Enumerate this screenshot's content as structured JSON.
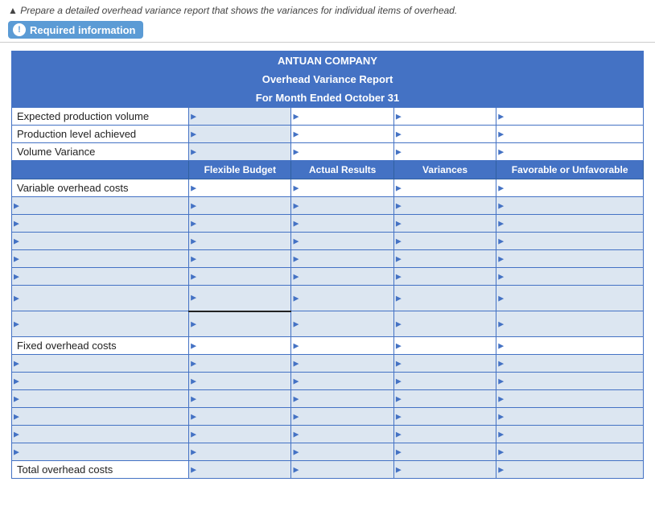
{
  "topNotice": "▲ Prepare a detailed overhead variance report that shows the variances for individual items of overhead.",
  "requiredBadge": {
    "icon": "!",
    "label": "Required information"
  },
  "report": {
    "title": "ANTUAN COMPANY",
    "subtitle": "Overhead Variance Report",
    "period": "For Month Ended October 31",
    "summaryRows": [
      {
        "label": "Expected production volume"
      },
      {
        "label": "Production level achieved"
      },
      {
        "label": "Volume Variance"
      }
    ],
    "columnHeaders": [
      "Flexible Budget",
      "Actual Results",
      "Variances",
      "Favorable or Unfavorable"
    ],
    "variableSection": "Variable overhead costs",
    "variableRows": 7,
    "fixedSection": "Fixed overhead costs",
    "fixedRows": 6,
    "totalRow": "Total overhead costs"
  }
}
